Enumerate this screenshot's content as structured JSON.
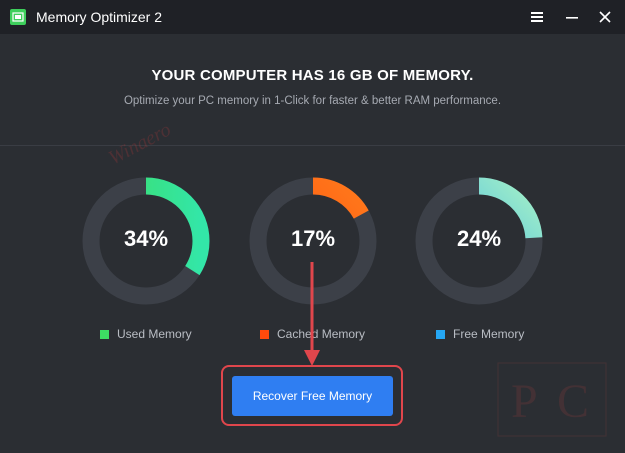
{
  "window": {
    "title": "Memory Optimizer 2",
    "icons": [
      "memory-chip-icon",
      "menu-icon",
      "minimize-icon",
      "close-icon"
    ]
  },
  "main": {
    "heading": "YOUR COMPUTER HAS 16 GB OF MEMORY.",
    "subheading": "Optimize your PC memory in 1-Click for faster & better RAM performance."
  },
  "gauges": [
    {
      "label": "34%",
      "fraction": 0.34,
      "color": "#3ddc63",
      "color_end": "#33e6a8"
    },
    {
      "label": "17%",
      "fraction": 0.17,
      "color": "#ff4a0c",
      "color_end": "#ff7a1c"
    },
    {
      "label": "24%",
      "fraction": 0.24,
      "color": "#25a6f3",
      "color_end": "#a4f0c6"
    }
  ],
  "legend": [
    {
      "label": "Used Memory",
      "color": "#3ddc63"
    },
    {
      "label": "Cached Memory",
      "color": "#ff4a0c"
    },
    {
      "label": "Free Memory",
      "color": "#25a6f3"
    }
  ],
  "actions": {
    "recover_label": "Recover Free Memory"
  },
  "colors": {
    "background": "#2b2e33",
    "titlebar": "#1f2126",
    "ring_track": "#3c4048",
    "button": "#2f7ef2",
    "annotation": "#e0464c"
  },
  "watermark": {
    "text": "Winaero PC",
    "mark": "PC"
  }
}
